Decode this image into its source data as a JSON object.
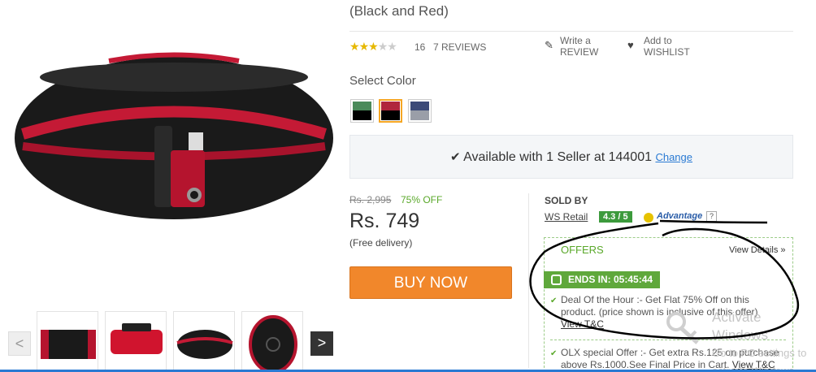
{
  "product": {
    "title": "(Black and Red)",
    "rating_count": "16",
    "reviews_link": "7 REVIEWS",
    "rating_value": 3,
    "rating_max": 5,
    "write_review_line1": "Write a",
    "write_review_line2": "REVIEW",
    "wishlist_line1": "Add to",
    "wishlist_line2": "WISHLIST",
    "select_color_label": "Select Color",
    "colors": [
      {
        "top": "#4a8a5a",
        "bottom": "#000000"
      },
      {
        "top": "#b0263c",
        "bottom": "#000000",
        "selected": true
      },
      {
        "top": "#3c4a78",
        "bottom": "#9a9ea8"
      }
    ],
    "availability": "Available with 1 Seller at 144001",
    "change_link": "Change",
    "mrp": "Rs. 2,995",
    "discount": "75% OFF",
    "price": "Rs. 749",
    "delivery": "(Free delivery)",
    "buy_now": "BUY NOW"
  },
  "seller": {
    "sold_by_label": "SOLD BY",
    "name": "WS Retail",
    "rating": "4.3 / 5",
    "advantage_label": "Advantage",
    "help_glyph": "?"
  },
  "offers": {
    "title": "OFFERS",
    "view_details": "View Details »",
    "ends_in": "ENDS IN: 05:45:44",
    "offer1": "Deal Of the Hour :- Get Flat 75% Off on this product. (price shown is inclusive of this offer)",
    "offer1_tc": "View T&C",
    "offer2": "OLX special Offer :- Get extra Rs.125 on purchase above Rs.1000.See Final Price in Cart.",
    "offer2_tc": "View T&C"
  },
  "watermark": {
    "line1": "Activate Windows",
    "line2": "Go to PC settings to activate Windows."
  },
  "gallery": {
    "prev_glyph": "<",
    "next_glyph": ">"
  },
  "icons": {
    "write_review": "pencil-icon",
    "wishlist": "heart-icon",
    "availability": "shield-check-icon",
    "offer_check": "check-icon",
    "timer": "clock-icon",
    "advantage": "advantage-badge-icon"
  },
  "colors_theme": {
    "buy_now": "#f1872b",
    "offer_green": "#5fa83b",
    "link_blue": "#2a7ad3"
  }
}
